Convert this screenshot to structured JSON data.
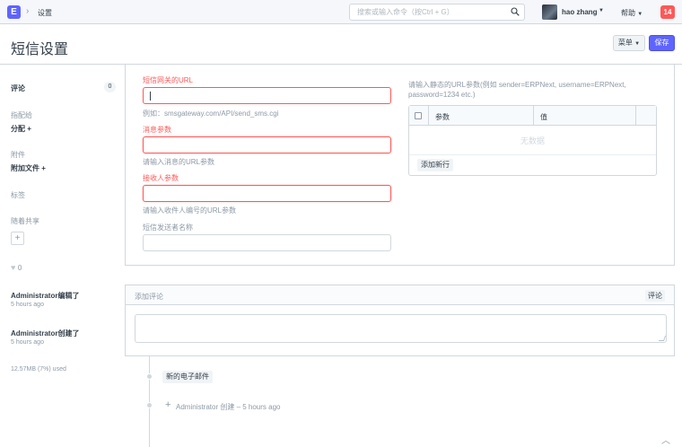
{
  "navbar": {
    "logo_letter": "E",
    "breadcrumb": "设置",
    "search_placeholder": "搜索或输入命令（按Ctrl + G）",
    "user_name": "hao zhang",
    "help_label": "帮助",
    "notification_count": "14"
  },
  "page": {
    "title": "短信设置",
    "menu_button": "菜单",
    "save_button": "保存"
  },
  "sidebar": {
    "comments_label": "评论",
    "comments_count": "0",
    "assigned_to_label": "指配给",
    "assign_action": "分配 +",
    "attachments_label": "附件",
    "attach_action": "附加文件 +",
    "tags_label": "标签",
    "shared_with_label": "随着共享",
    "likes_count": "0",
    "activity": [
      {
        "text": "Administrator编辑了",
        "time": "5 hours ago"
      },
      {
        "text": "Administrator创建了",
        "time": "5 hours ago"
      }
    ],
    "storage_used": "12.57MB (7%) used"
  },
  "form": {
    "gateway_url_label": "短信网关的URL",
    "gateway_url_value": "",
    "gateway_url_help": "例如：smsgateway.com/API/send_sms.cgi",
    "message_param_label": "消息参数",
    "message_param_value": "",
    "message_param_help": "请输入消息的URL参数",
    "receiver_param_label": "接收人参数",
    "receiver_param_value": "",
    "receiver_param_help": "请输入收件人编号的URL参数",
    "sender_name_label": "短信发送者名称",
    "sender_name_value": "",
    "static_params_desc": "请输入静态的URL参数(例如 sender=ERPNext, username=ERPNext, password=1234 etc.)",
    "grid_headers": [
      "参数",
      "值"
    ],
    "grid_no_data": "无数据",
    "add_row_button": "添加新行"
  },
  "comment": {
    "title": "添加评论",
    "button": "评论",
    "value": ""
  },
  "timeline": {
    "new_email_button": "新的电子邮件",
    "created_entry": "Administrator 创建 – 5 hours ago"
  },
  "colors": {
    "primary": "#5e64ff",
    "danger": "#ff5858",
    "muted": "#8d99a6",
    "border": "#d1d8dd"
  }
}
